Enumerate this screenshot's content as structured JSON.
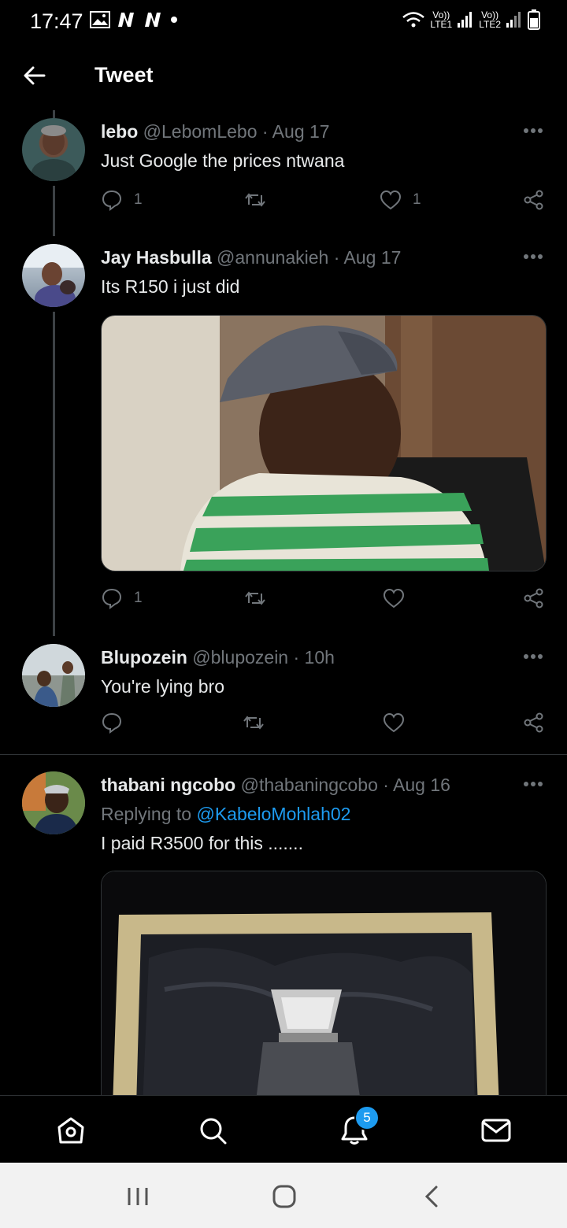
{
  "status_bar": {
    "time": "17:47",
    "sim1_label_top": "Vo))",
    "sim1_label_bottom": "LTE1",
    "sim2_label_top": "Vo))",
    "sim2_label_bottom": "LTE2"
  },
  "header": {
    "title": "Tweet"
  },
  "tweets": [
    {
      "name": "lebo",
      "handle": "@LebomLebo",
      "date": "· Aug 17",
      "text": "Just Google the prices ntwana",
      "reply_count": "1",
      "like_count": "1"
    },
    {
      "name": "Jay Hasbulla",
      "handle": "@annunakieh",
      "date": "· Aug 17",
      "text": "Its R150 i just did",
      "reply_count": "1",
      "like_count": ""
    },
    {
      "name": "Blupozein",
      "handle": "@blupozein",
      "date": "· 10h",
      "text": "You're lying bro",
      "reply_count": "",
      "like_count": ""
    },
    {
      "name": "thabani ngcobo",
      "handle": "@thabaningcobo",
      "date": "· Aug 16",
      "replying_label": "Replying to",
      "replying_mention": "@KabeloMohlah02",
      "text": "I paid R3500 for this ......."
    }
  ],
  "bottom_nav": {
    "notification_count": "5"
  },
  "colors": {
    "accent": "#1d9bf0",
    "background": "#000000",
    "muted_text": "#71767b"
  }
}
